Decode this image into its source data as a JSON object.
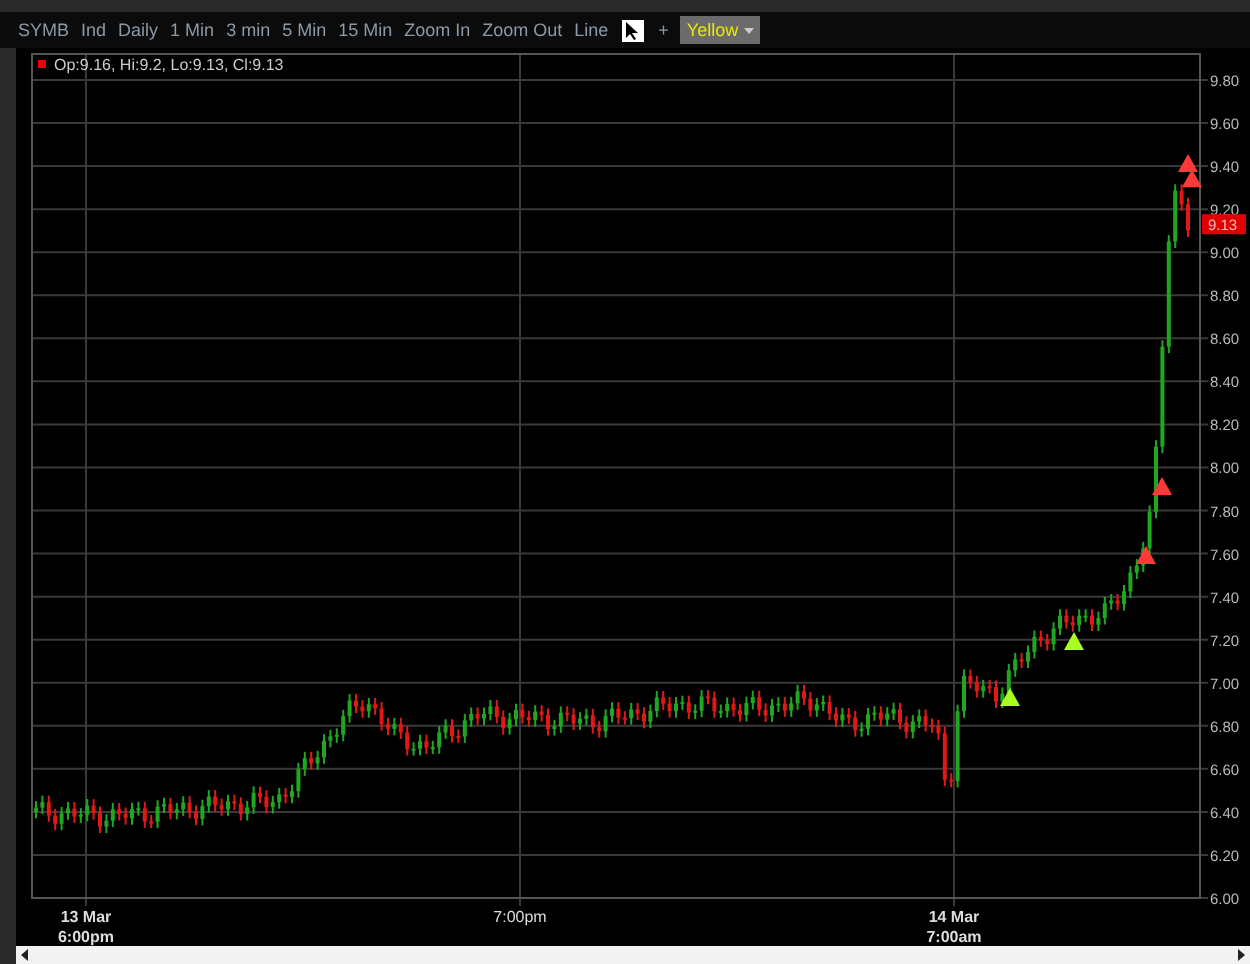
{
  "toolbar": {
    "buttons": [
      "SYMB",
      "Ind",
      "Daily",
      "1 Min",
      "3 min",
      "5 Min",
      "15 Min",
      "Zoom In",
      "Zoom Out",
      "Line"
    ],
    "extra_button": "+",
    "color_dropdown": "Yellow"
  },
  "chart": {
    "readout": "Op:9.16, Hi:9.2, Lo:9.13, Cl:9.13",
    "last_price": "9.13",
    "y_labels": [
      "9.80",
      "9.60",
      "9.40",
      "9.20",
      "9.00",
      "8.80",
      "8.60",
      "8.40",
      "8.20",
      "8.00",
      "7.80",
      "7.60",
      "7.40",
      "7.20",
      "7.00",
      "6.80",
      "6.60",
      "6.40",
      "6.20",
      "6.00"
    ],
    "x_labels": [
      {
        "kind": "date",
        "lines": [
          "13 Mar",
          "6:00pm"
        ]
      },
      {
        "kind": "time",
        "lines": [
          "7:00pm"
        ]
      },
      {
        "kind": "date",
        "lines": [
          "14 Mar",
          "7:00am"
        ]
      }
    ]
  }
}
